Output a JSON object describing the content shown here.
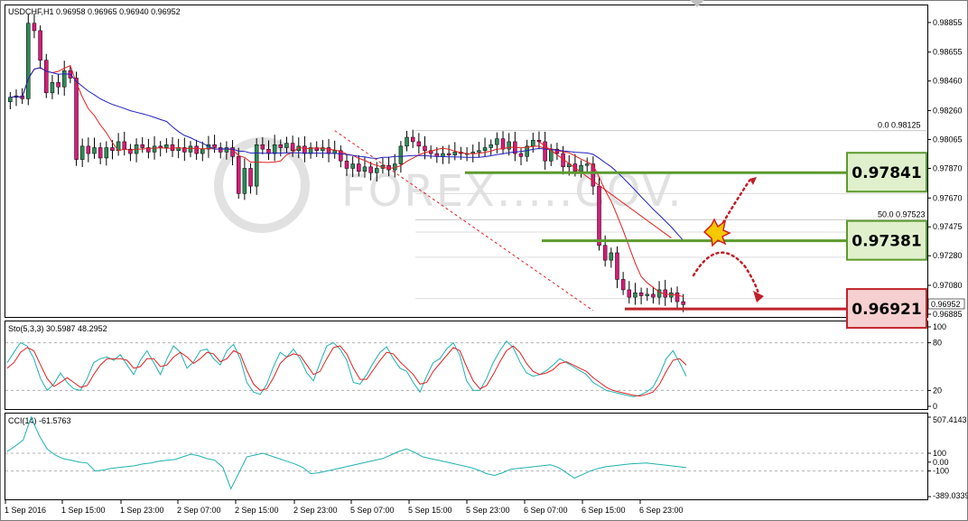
{
  "header": {
    "symbol_line": "USDCHF,H1  0.96958 0.96965 0.96940 0.96952"
  },
  "watermark": "FOREX.....COV.",
  "colors": {
    "bull": "#2e8b57",
    "bear": "#d81b7a",
    "ma_fast": "#e02020",
    "ma_slow": "#2020c0",
    "sto_main": "#20b0b0",
    "sto_signal": "#e02020",
    "cci": "#20b0b0",
    "resistance_box": "#5c9a2e",
    "support_box": "#c0242b"
  },
  "chart_data": [
    {
      "type": "candlestick",
      "title": "USDCHF,H1  0.96958 0.96965 0.96940 0.96952",
      "ylim": [
        0.96885,
        0.98885
      ],
      "y_ticks": [
        "0.98855",
        "0.98655",
        "0.98460",
        "0.98260",
        "0.98065",
        "0.97870",
        "0.97670",
        "0.97475",
        "0.97280",
        "0.97080",
        "0.96952",
        "0.96885"
      ],
      "x_ticks": [
        "1 Sep 2016",
        "1 Sep 15:00",
        "1 Sep 23:00",
        "2 Sep 07:00",
        "2 Sep 15:00",
        "2 Sep 23:00",
        "5 Sep 07:00",
        "5 Sep 15:00",
        "5 Sep 23:00",
        "6 Sep 07:00",
        "6 Sep 15:00",
        "6 Sep 23:00"
      ],
      "last_price": "0.96952",
      "fib_levels": [
        {
          "label": "0.0  0.98125",
          "value": 0.98125
        },
        {
          "label": "50.0  0.97523",
          "value": 0.97523
        }
      ],
      "levels": [
        {
          "name": "resistance",
          "label": "0.97841",
          "value": 0.97841
        },
        {
          "name": "resistance",
          "label": "0.97381",
          "value": 0.97381
        },
        {
          "name": "support",
          "label": "0.96921",
          "value": 0.96921
        }
      ],
      "closes": [
        0.9835,
        0.9836,
        0.9834,
        0.9885,
        0.988,
        0.986,
        0.9838,
        0.9845,
        0.9842,
        0.9853,
        0.9848,
        0.9793,
        0.9802,
        0.9797,
        0.9801,
        0.9794,
        0.9801,
        0.9799,
        0.9805,
        0.98,
        0.9797,
        0.9803,
        0.9801,
        0.9798,
        0.9802,
        0.9801,
        0.9803,
        0.9799,
        0.9801,
        0.9798,
        0.9802,
        0.9797,
        0.98,
        0.9803,
        0.9801,
        0.9798,
        0.9801,
        0.9795,
        0.977,
        0.9787,
        0.9775,
        0.9803,
        0.98,
        0.9797,
        0.9803,
        0.9801,
        0.9804,
        0.9799,
        0.9802,
        0.9797,
        0.9801,
        0.9799,
        0.9801,
        0.9797,
        0.9799,
        0.9792,
        0.9787,
        0.979,
        0.9785,
        0.9788,
        0.9784,
        0.9787,
        0.9789,
        0.9786,
        0.979,
        0.9802,
        0.9808,
        0.9805,
        0.9802,
        0.9799,
        0.9797,
        0.9795,
        0.9797,
        0.9796,
        0.9798,
        0.9797,
        0.9797,
        0.9798,
        0.9799,
        0.9801,
        0.9803,
        0.9807,
        0.98,
        0.9805,
        0.9797,
        0.9795,
        0.9802,
        0.9806,
        0.9805,
        0.9792,
        0.98,
        0.9797,
        0.9788,
        0.979,
        0.9785,
        0.9789,
        0.979,
        0.9775,
        0.9735,
        0.9725,
        0.973,
        0.9712,
        0.9705,
        0.97,
        0.9703,
        0.9701,
        0.9702,
        0.97,
        0.9705,
        0.97,
        0.9703,
        0.9697,
        0.9695
      ]
    },
    {
      "type": "line",
      "title": "Sto(5,3,3) 30.5987 48.2952",
      "ylim": [
        0,
        100
      ],
      "y_ticks": [
        "100",
        "80",
        "20",
        "0"
      ],
      "series": [
        {
          "name": "main",
          "values": [
            55,
            68,
            80,
            76,
            60,
            35,
            20,
            28,
            42,
            30,
            22,
            20,
            35,
            55,
            60,
            62,
            58,
            65,
            52,
            40,
            58,
            70,
            55,
            40,
            60,
            76,
            68,
            48,
            56,
            70,
            72,
            60,
            52,
            70,
            78,
            60,
            30,
            18,
            15,
            28,
            50,
            68,
            62,
            72,
            60,
            42,
            32,
            55,
            76,
            80,
            72,
            58,
            30,
            28,
            40,
            55,
            68,
            75,
            60,
            48,
            44,
            30,
            18,
            38,
            55,
            60,
            72,
            80,
            64,
            32,
            20,
            20,
            35,
            55,
            70,
            82,
            74,
            56,
            42,
            38,
            40,
            45,
            52,
            60,
            55,
            50,
            45,
            40,
            30,
            25,
            20,
            18,
            16,
            14,
            12,
            14,
            18,
            24,
            40,
            60,
            70,
            55,
            38
          ]
        },
        {
          "name": "signal",
          "values": [
            48,
            55,
            68,
            74,
            70,
            52,
            35,
            25,
            30,
            36,
            30,
            24,
            26,
            40,
            52,
            60,
            60,
            60,
            58,
            48,
            50,
            60,
            60,
            50,
            52,
            62,
            68,
            62,
            54,
            60,
            68,
            66,
            56,
            60,
            70,
            66,
            45,
            28,
            20,
            22,
            36,
            54,
            62,
            66,
            64,
            52,
            40,
            44,
            60,
            74,
            76,
            66,
            48,
            34,
            34,
            46,
            58,
            68,
            66,
            56,
            48,
            40,
            28,
            30,
            44,
            54,
            64,
            74,
            70,
            50,
            32,
            22,
            26,
            40,
            56,
            70,
            76,
            68,
            54,
            44,
            40,
            42,
            46,
            54,
            56,
            52,
            48,
            44,
            36,
            30,
            24,
            20,
            18,
            16,
            14,
            13,
            15,
            18,
            28,
            44,
            58,
            60,
            52
          ]
        }
      ]
    },
    {
      "type": "line",
      "title": "CCI(14) -61.5763",
      "ylim": [
        -389.0339,
        507.4143
      ],
      "y_ticks": [
        "507.4143",
        "100",
        "0.00",
        "-100",
        "-389.0339"
      ],
      "series": [
        {
          "name": "CCI",
          "values": [
            120,
            180,
            250,
            507,
            300,
            150,
            80,
            40,
            20,
            0,
            -10,
            -100,
            -90,
            -70,
            -60,
            -50,
            -40,
            -20,
            -10,
            10,
            20,
            30,
            60,
            90,
            70,
            40,
            20,
            -60,
            -300,
            -120,
            60,
            80,
            100,
            70,
            40,
            10,
            -20,
            -60,
            -130,
            -120,
            -100,
            -80,
            -60,
            -40,
            -20,
            0,
            20,
            40,
            80,
            120,
            150,
            110,
            60,
            40,
            20,
            0,
            -20,
            -40,
            -60,
            -90,
            -130,
            -150,
            -120,
            -80,
            -70,
            -60,
            -50,
            -40,
            -30,
            -60,
            -120,
            -180,
            -140,
            -100,
            -70,
            -50,
            -40,
            -30,
            -20,
            -15,
            -10,
            -20,
            -30,
            -40,
            -50,
            -61.5763
          ]
        }
      ]
    }
  ]
}
